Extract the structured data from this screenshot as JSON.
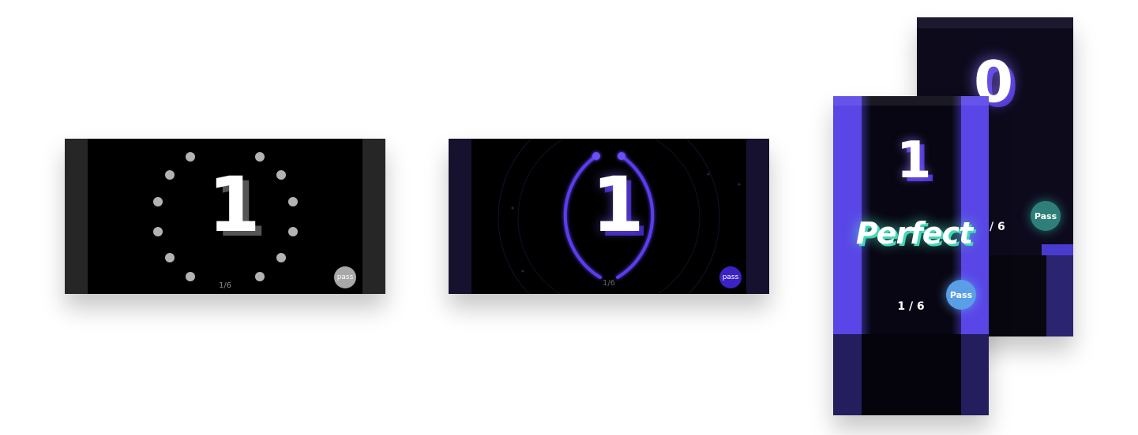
{
  "screen1": {
    "number": "1",
    "counter": "1/6",
    "pass_label": "pass",
    "colors": {
      "frame": "#262626",
      "dots": "#b3b3b3",
      "pass_button": "#a8a8a8"
    }
  },
  "screen2": {
    "number": "1",
    "counter": "1/6",
    "pass_label": "pass",
    "colors": {
      "arc": "#5a3df0",
      "pass_button": "#3b22c4",
      "frame": "#15112e"
    }
  },
  "screen3": {
    "number": "1",
    "result_label": "Perfect",
    "counter": "1 / 6",
    "pass_label": "Pass",
    "colors": {
      "side_bars": "#5a46e6",
      "result_glow": "#50f0c8",
      "pass_button": "#5a9ee6"
    }
  },
  "screen4": {
    "number": "0",
    "counter": "/ 6",
    "pass_label": "Pass",
    "colors": {
      "pass_button": "#2e7f7a",
      "background": "#0d0a1c"
    }
  }
}
